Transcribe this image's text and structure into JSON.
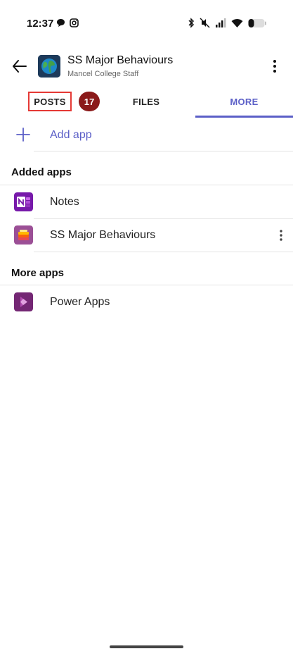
{
  "status_bar": {
    "time": "12:37"
  },
  "header": {
    "team_name": "SS Major Behaviours",
    "team_subtitle": "Mancel College Staff"
  },
  "tabs": [
    {
      "label": "POSTS"
    },
    {
      "label": "FILES"
    },
    {
      "label": "MORE",
      "active": true
    }
  ],
  "posts_badge": "17",
  "add_app": {
    "label": "Add app"
  },
  "sections": {
    "added_apps": {
      "title": "Added apps",
      "items": [
        {
          "label": "Notes",
          "icon": "onenote-icon"
        },
        {
          "label": "SS Major Behaviours",
          "icon": "lists-icon"
        }
      ]
    },
    "more_apps": {
      "title": "More apps",
      "items": [
        {
          "label": "Power Apps",
          "icon": "power-apps-icon"
        }
      ]
    }
  },
  "colors": {
    "accent": "#5b5fc7",
    "badge": "#8b1a1a",
    "highlight_box": "#e53935"
  }
}
